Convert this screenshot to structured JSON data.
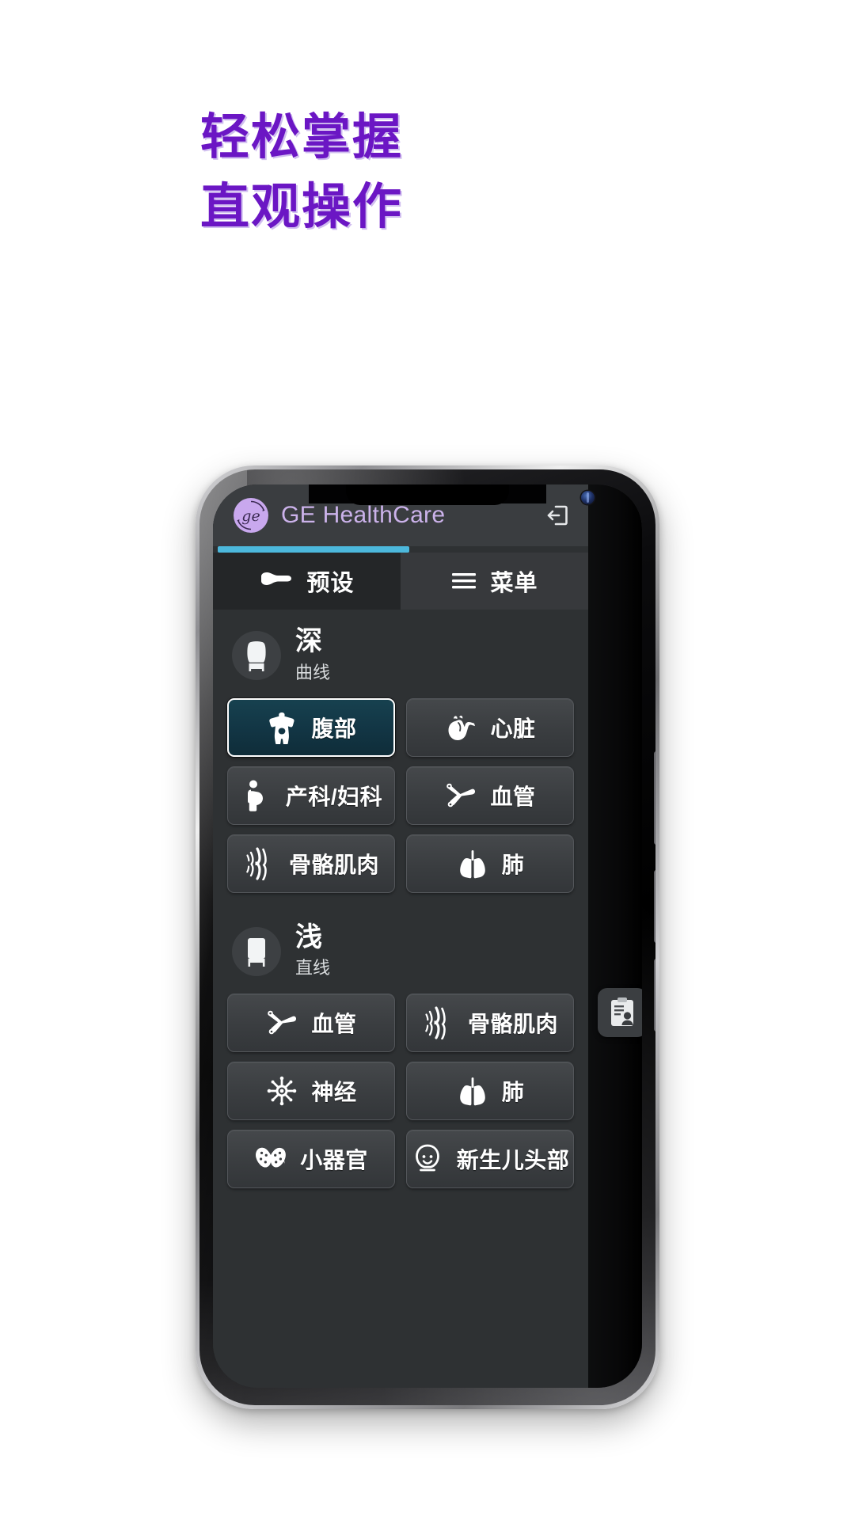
{
  "headline": {
    "line1": "轻松掌握",
    "line2": "直观操作",
    "color": "#6b16c4"
  },
  "app": {
    "brand": {
      "logo_icon": "ge-monogram-icon",
      "name": "GE HealthCare",
      "name_color": "#cbb2ea"
    },
    "header_actions": [
      {
        "icon": "logout-icon",
        "name": "logout"
      }
    ],
    "accent_color": "#4cb8dc",
    "tabs": [
      {
        "label": "预设",
        "icon": "ultrasound-probe-icon",
        "active": true
      },
      {
        "label": "菜单",
        "icon": "hamburger-menu-icon",
        "active": false
      }
    ],
    "floating_tab": {
      "icon": "clipboard-patient-icon",
      "name": "worksheet"
    },
    "groups": [
      {
        "title": "深",
        "subtitle": "曲线",
        "icon": "curved-probe-icon",
        "presets": [
          {
            "label": "腹部",
            "icon": "abdomen-icon",
            "selected": true
          },
          {
            "label": "心脏",
            "icon": "heart-icon",
            "selected": false
          },
          {
            "label": "产科/妇科",
            "icon": "obgyn-icon",
            "selected": false
          },
          {
            "label": "血管",
            "icon": "vascular-icon",
            "selected": false
          },
          {
            "label": "骨骼肌肉",
            "icon": "musculoskeletal-icon",
            "selected": false
          },
          {
            "label": "肺",
            "icon": "lung-icon",
            "selected": false
          }
        ]
      },
      {
        "title": "浅",
        "subtitle": "直线",
        "icon": "linear-probe-icon",
        "presets": [
          {
            "label": "血管",
            "icon": "vascular-icon",
            "selected": false
          },
          {
            "label": "骨骼肌肉",
            "icon": "musculoskeletal-icon",
            "selected": false
          },
          {
            "label": "神经",
            "icon": "nerve-icon",
            "selected": false
          },
          {
            "label": "肺",
            "icon": "lung-icon",
            "selected": false
          },
          {
            "label": "小器官",
            "icon": "thyroid-icon",
            "selected": false
          },
          {
            "label": "新生儿头部",
            "icon": "neonatal-head-icon",
            "selected": false
          }
        ]
      }
    ]
  }
}
